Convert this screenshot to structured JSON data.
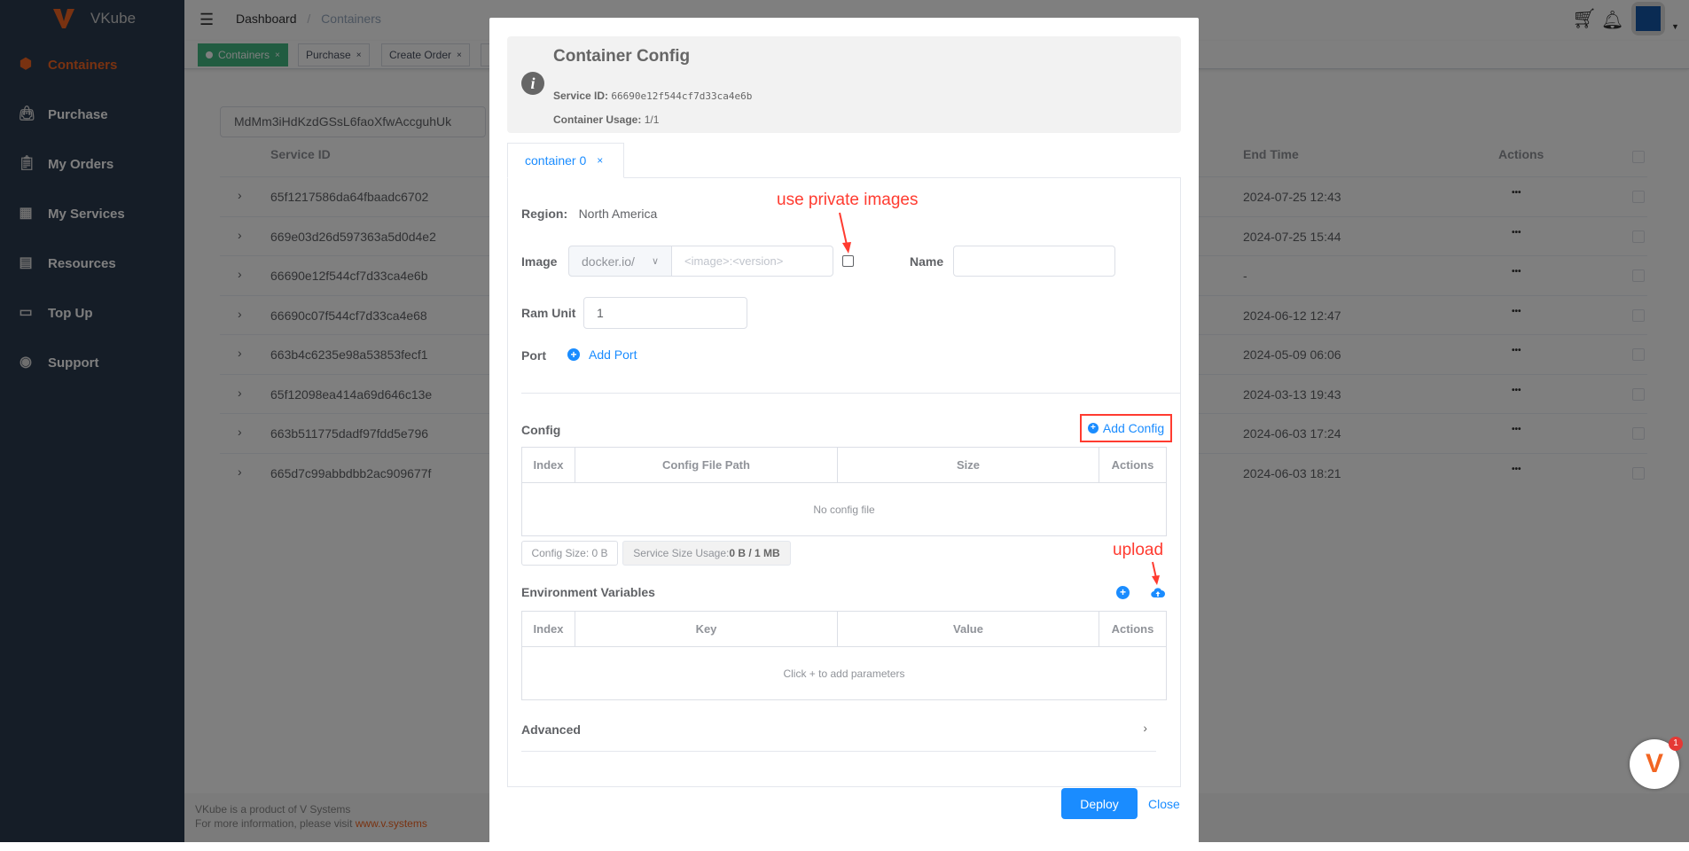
{
  "app": {
    "name": "VKube",
    "brand_color": "#f26522"
  },
  "sidebar": {
    "items": [
      {
        "label": "Containers",
        "icon": "cube-icon",
        "active": true
      },
      {
        "label": "Purchase",
        "icon": "bag-icon"
      },
      {
        "label": "My Orders",
        "icon": "clipboard-icon"
      },
      {
        "label": "My Services",
        "icon": "store-icon"
      },
      {
        "label": "Resources",
        "icon": "documents-icon"
      },
      {
        "label": "Top Up",
        "icon": "wallet-icon"
      },
      {
        "label": "Support",
        "icon": "support-icon"
      }
    ]
  },
  "header": {
    "breadcrumb": [
      "Dashboard",
      "Containers"
    ]
  },
  "tags": [
    {
      "label": "Containers",
      "active": true
    },
    {
      "label": "Purchase"
    },
    {
      "label": "Create Order"
    }
  ],
  "search": {
    "value": "MdMm3iHdKzdGSsL6faoXfwAccguhUk"
  },
  "table": {
    "headers": {
      "service_id": "Service ID",
      "end_time": "End Time",
      "actions": "Actions"
    },
    "rows": [
      {
        "id": "65f1217586da64fbaadc6702",
        "end": "2024-07-25 12:43"
      },
      {
        "id": "669e03d26d597363a5d0d4e2",
        "end": "2024-07-25 15:44"
      },
      {
        "id": "66690e12f544cf7d33ca4e6b",
        "end": "-"
      },
      {
        "id": "66690c07f544cf7d33ca4e68",
        "end": "2024-06-12 12:47"
      },
      {
        "id": "663b4c6235e98a53853fecf1",
        "end": "2024-05-09 06:06"
      },
      {
        "id": "65f12098ea414a69d646c13e",
        "end": "2024-03-13 19:43"
      },
      {
        "id": "663b511775dadf97fdd5e796",
        "end": "2024-06-03 17:24"
      },
      {
        "id": "665d7c99abbdbb2ac909677f",
        "end": "2024-06-03 18:21"
      }
    ],
    "actions_label": "•••"
  },
  "footer": {
    "line1": "VKube is a product of V Systems",
    "line2": "For more information, please visit ",
    "link": "www.v.systems"
  },
  "notification_badge": "1",
  "modal": {
    "title": "Container Config",
    "service_id_label": "Service ID:",
    "service_id": "66690e12f544cf7d33ca4e6b",
    "usage_label": "Container Usage:",
    "usage": "1/1",
    "tab": "container 0",
    "region_label": "Region:",
    "region": "North America",
    "image_label": "Image",
    "registry": "docker.io/",
    "image_placeholder": "<image>:<version>",
    "name_label": "Name",
    "name_value": "",
    "ram_label": "Ram Unit",
    "ram_value": "1",
    "port_label": "Port",
    "add_port": "Add Port",
    "config_label": "Config",
    "add_config": "Add Config",
    "config_headers": [
      "Index",
      "Config File Path",
      "Size",
      "Actions"
    ],
    "config_empty": "No config file",
    "config_size": "Config Size: 0 B",
    "usage_size_label": "Service Size Usage: ",
    "usage_size": "0 B / 1 MB",
    "env_label": "Environment Variables",
    "env_headers": [
      "Index",
      "Key",
      "Value",
      "Actions"
    ],
    "env_empty": "Click + to add parameters",
    "advanced": "Advanced",
    "deploy": "Deploy",
    "close": "Close"
  },
  "annotations": {
    "private": "use private images",
    "upload": "upload",
    "color": "#ff3b30"
  }
}
